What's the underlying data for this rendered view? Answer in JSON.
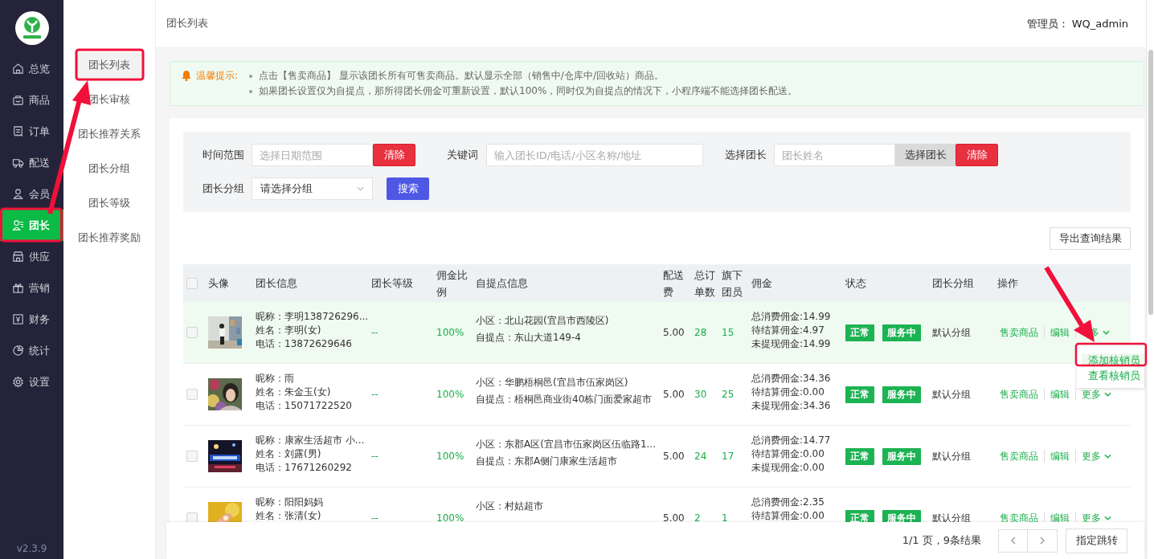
{
  "sidebar": {
    "items": [
      {
        "label": "总览",
        "selected": false
      },
      {
        "label": "商品",
        "selected": false
      },
      {
        "label": "订单",
        "selected": false
      },
      {
        "label": "配送",
        "selected": false
      },
      {
        "label": "会员",
        "selected": false
      },
      {
        "label": "团长",
        "selected": true
      },
      {
        "label": "供应",
        "selected": false
      },
      {
        "label": "营销",
        "selected": false
      },
      {
        "label": "财务",
        "selected": false
      },
      {
        "label": "统计",
        "selected": false
      },
      {
        "label": "设置",
        "selected": false
      }
    ],
    "version": "v2.3.9"
  },
  "subnav": {
    "items": [
      {
        "label": "团长列表",
        "selected": true
      },
      {
        "label": "团长审核",
        "selected": false
      },
      {
        "label": "团长推荐关系",
        "selected": false
      },
      {
        "label": "团长分组",
        "selected": false
      },
      {
        "label": "团长等级",
        "selected": false
      },
      {
        "label": "团长推荐奖励",
        "selected": false
      }
    ]
  },
  "header": {
    "title": "团长列表",
    "admin_label": "管理员：",
    "admin_name": "WQ_admin"
  },
  "notice": {
    "title": "温馨提示:",
    "lines": [
      "点击【售卖商品】 显示该团长所有可售卖商品。默认显示全部（销售中/仓库中/回收站）商品。",
      "如果团长设置仅为自提点，那所得团长佣金可重新设置，默认100%，同时仅为自提点的情况下，小程序端不能选择团长配送。"
    ]
  },
  "filters": {
    "date": {
      "label": "时间范围",
      "placeholder": "选择日期范围",
      "clear": "清除"
    },
    "keyword": {
      "label": "关键词",
      "placeholder": "输入团长ID/电话/小区名称/地址"
    },
    "leader": {
      "label": "选择团长",
      "placeholder": "团长姓名",
      "pick": "选择团长",
      "clear": "清除"
    },
    "group": {
      "label": "团长分组",
      "value": "请选择分组"
    },
    "search": "搜索"
  },
  "export_button": "导出查询结果",
  "table": {
    "select_all": {
      "checked": false
    },
    "columns": [
      "头像",
      "团长信息",
      "团长等级",
      "佣金比例",
      "自提点信息",
      "配送费",
      "总订单数",
      "旗下团员",
      "佣金",
      "状态",
      "团长分组",
      "操作"
    ],
    "rows": [
      {
        "checked": false,
        "highlighted": true,
        "info": [
          "昵称：李明138726296...",
          "姓名：李明(女)",
          "电话：13872629646"
        ],
        "level": "--",
        "ratio": "100%",
        "address": [
          "小区：北山花园(宜昌市西陵区)",
          "自提点：东山大道149-4"
        ],
        "fee": "5.00",
        "orders": "28",
        "members": "15",
        "commission": [
          "总消费佣金:14.99",
          "待结算佣金:4.97",
          "未提现佣金:14.99"
        ],
        "status": [
          "正常",
          "服务中"
        ],
        "group": "默认分组",
        "actions": [
          "售卖商品",
          "编辑",
          "多"
        ],
        "menu": [
          {
            "label": "添加核销员",
            "selected": true
          },
          {
            "label": "查看核销员",
            "selected": false
          }
        ]
      },
      {
        "checked": false,
        "highlighted": false,
        "info": [
          "昵称：雨",
          "姓名：朱金玉(女)",
          "电话：15071722520"
        ],
        "level": "--",
        "ratio": "100%",
        "address": [
          "小区：华鹏梧桐邑(宜昌市伍家岗区)",
          "自提点：梧桐邑商业街40栋门面爱家超市"
        ],
        "fee": "5.00",
        "orders": "30",
        "members": "25",
        "commission": [
          "总消费佣金:34.36",
          "待结算佣金:0.00",
          "未提现佣金:34.36"
        ],
        "status": [
          "正常",
          "服务中"
        ],
        "group": "默认分组",
        "actions": [
          "售卖商品",
          "编辑",
          "更多"
        ]
      },
      {
        "checked": false,
        "highlighted": false,
        "info": [
          "昵称：康家生活超市 小...",
          "姓名：刘露(男)",
          "电话：17671260292"
        ],
        "level": "--",
        "ratio": "100%",
        "address": [
          "小区：东郡A区(宜昌市伍家岗区伍临路1...",
          "自提点：东郡A侧门康家生活超市"
        ],
        "fee": "5.00",
        "orders": "24",
        "members": "17",
        "commission": [
          "总消费佣金:14.77",
          "待结算佣金:0.00",
          "未提现佣金:0.00"
        ],
        "status": [
          "正常",
          "服务中"
        ],
        "group": "默认分组",
        "actions": [
          "售卖商品",
          "编辑",
          "更多"
        ]
      },
      {
        "checked": false,
        "highlighted": false,
        "info": [
          "昵称：阳阳妈妈",
          "姓名：张清(女)"
        ],
        "level": "--",
        "ratio": "100%",
        "address": [
          "小区：村姑超市"
        ],
        "fee": "5.00",
        "orders": "2",
        "members": "1",
        "commission": [
          "总消费佣金:2.35",
          "待结算佣金:0.00"
        ],
        "status": [
          "正常",
          "服务中"
        ],
        "group": "默认分组",
        "actions": [
          "售卖商品",
          "编辑",
          "更多"
        ]
      }
    ]
  },
  "pagination": {
    "summary": "1/1 页，9条结果",
    "jump": "指定跳转"
  }
}
